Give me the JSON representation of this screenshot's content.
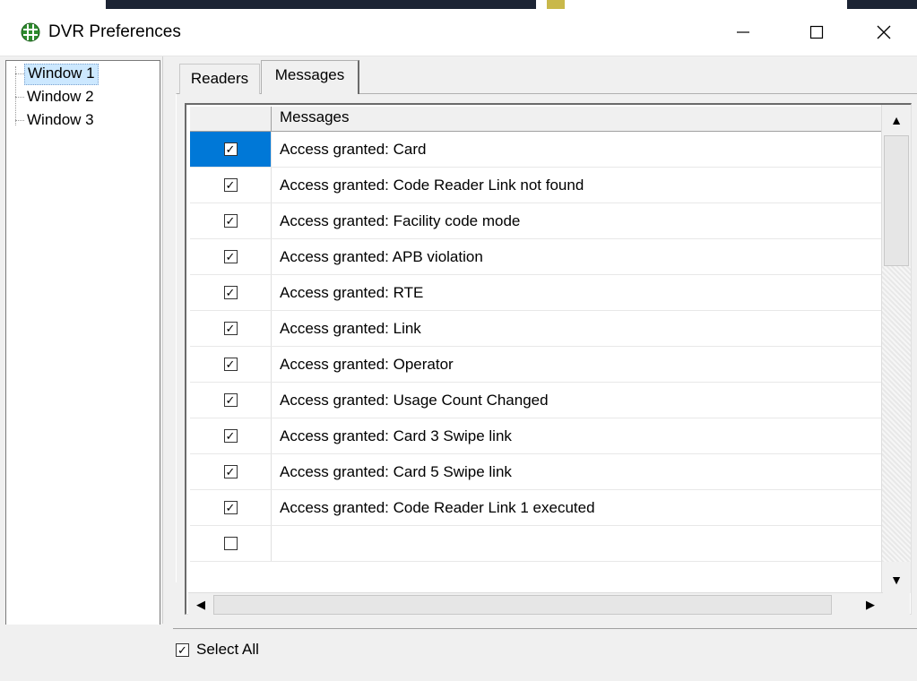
{
  "window": {
    "title": "DVR Preferences",
    "controls": {
      "minimize": "—",
      "maximize": "☐",
      "close": "✕"
    }
  },
  "tree": {
    "items": [
      "Window 1",
      "Window 2",
      "Window 3"
    ],
    "selected_index": 0
  },
  "tabs": [
    {
      "label": "Readers",
      "active": false
    },
    {
      "label": "Messages",
      "active": true
    }
  ],
  "grid": {
    "header": "Messages",
    "rows": [
      {
        "checked": true,
        "text": "Access granted: Card"
      },
      {
        "checked": true,
        "text": "Access granted: Code Reader Link not found"
      },
      {
        "checked": true,
        "text": "Access granted: Facility code mode"
      },
      {
        "checked": true,
        "text": "Access granted: APB violation"
      },
      {
        "checked": true,
        "text": "Access granted: RTE"
      },
      {
        "checked": true,
        "text": "Access granted: Link"
      },
      {
        "checked": true,
        "text": "Access granted: Operator"
      },
      {
        "checked": true,
        "text": "Access granted: Usage Count Changed"
      },
      {
        "checked": true,
        "text": "Access granted: Card 3 Swipe link"
      },
      {
        "checked": true,
        "text": "Access granted: Card 5 Swipe link"
      },
      {
        "checked": true,
        "text": "Access granted: Code Reader Link 1 executed"
      }
    ],
    "selected_row": 0
  },
  "footer": {
    "select_all_label": "Select All",
    "select_all_checked": true
  },
  "colors": {
    "selection": "#0078d7",
    "tree_selection": "#cce8ff"
  },
  "icons": {
    "check": "✓",
    "arrow_up": "▲",
    "arrow_down": "▼",
    "arrow_left": "◀",
    "arrow_right": "▶"
  }
}
